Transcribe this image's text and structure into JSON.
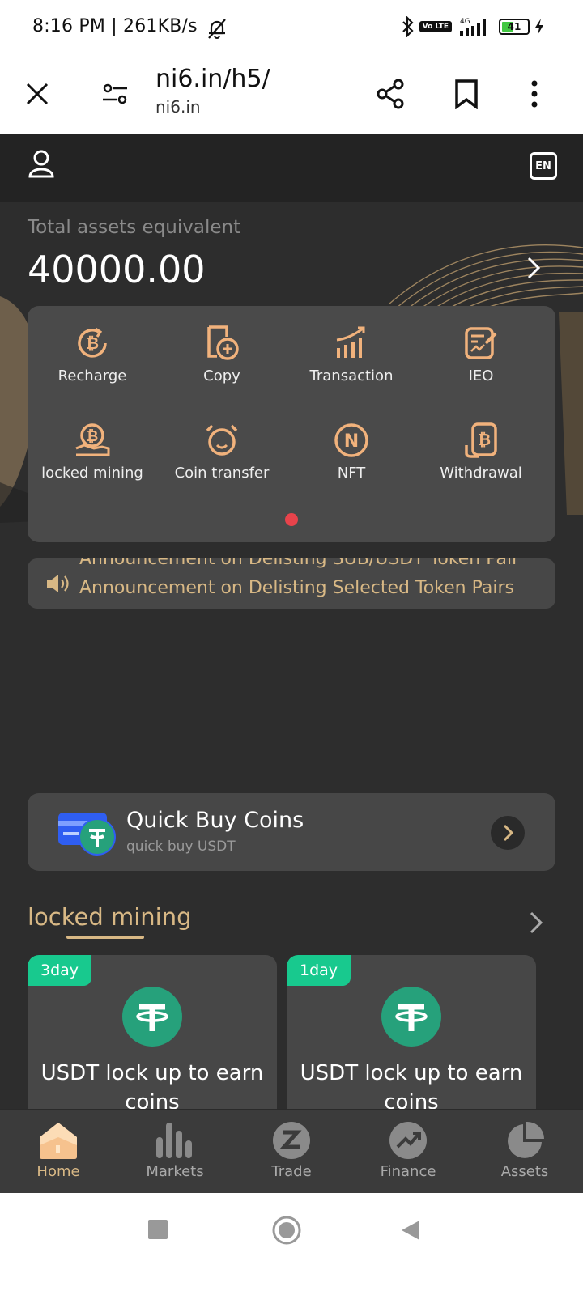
{
  "status_bar": {
    "time": "8:16 PM | 261KB/s",
    "network": "4G",
    "volte": "Vo LTE",
    "battery": "41"
  },
  "browser": {
    "url": "ni6.in/h5/",
    "host": "ni6.in"
  },
  "header": {
    "lang": "EN"
  },
  "assets": {
    "label": "Total assets equivalent",
    "value": "40000.00"
  },
  "menu": [
    {
      "label": "Recharge",
      "icon": "bitcoin-refresh-icon"
    },
    {
      "label": "Copy",
      "icon": "copy-plus-icon"
    },
    {
      "label": "Transaction",
      "icon": "chart-up-icon"
    },
    {
      "label": "IEO",
      "icon": "document-edit-icon"
    },
    {
      "label": "locked mining",
      "icon": "bitcoin-hand-icon"
    },
    {
      "label": "Coin transfer",
      "icon": "alarm-transfer-icon"
    },
    {
      "label": "NFT",
      "icon": "nft-coin-icon"
    },
    {
      "label": "Withdrawal",
      "icon": "bitcoin-wallet-icon"
    }
  ],
  "notice": {
    "line1": "Announcement on Delisting SUB/USDT Token Pair",
    "line2": "Announcement on Delisting Selected Token Pairs"
  },
  "quick_buy": {
    "title": "Quick Buy Coins",
    "subtitle": "quick buy USDT"
  },
  "locked_mining": {
    "title": "locked mining",
    "cards": [
      {
        "badge": "3day",
        "text": "USDT lock up to earn coins"
      },
      {
        "badge": "1day",
        "text": "USDT lock up to earn coins"
      }
    ]
  },
  "nav": [
    {
      "label": "Home",
      "active": true
    },
    {
      "label": "Markets",
      "active": false
    },
    {
      "label": "Trade",
      "active": false
    },
    {
      "label": "Finance",
      "active": false
    },
    {
      "label": "Assets",
      "active": false
    }
  ],
  "colors": {
    "accent": "#d8b885",
    "icon_orange": "#f1b27c",
    "teal": "#18c98e",
    "usdt": "#26a17b",
    "dot": "#e8434b"
  }
}
